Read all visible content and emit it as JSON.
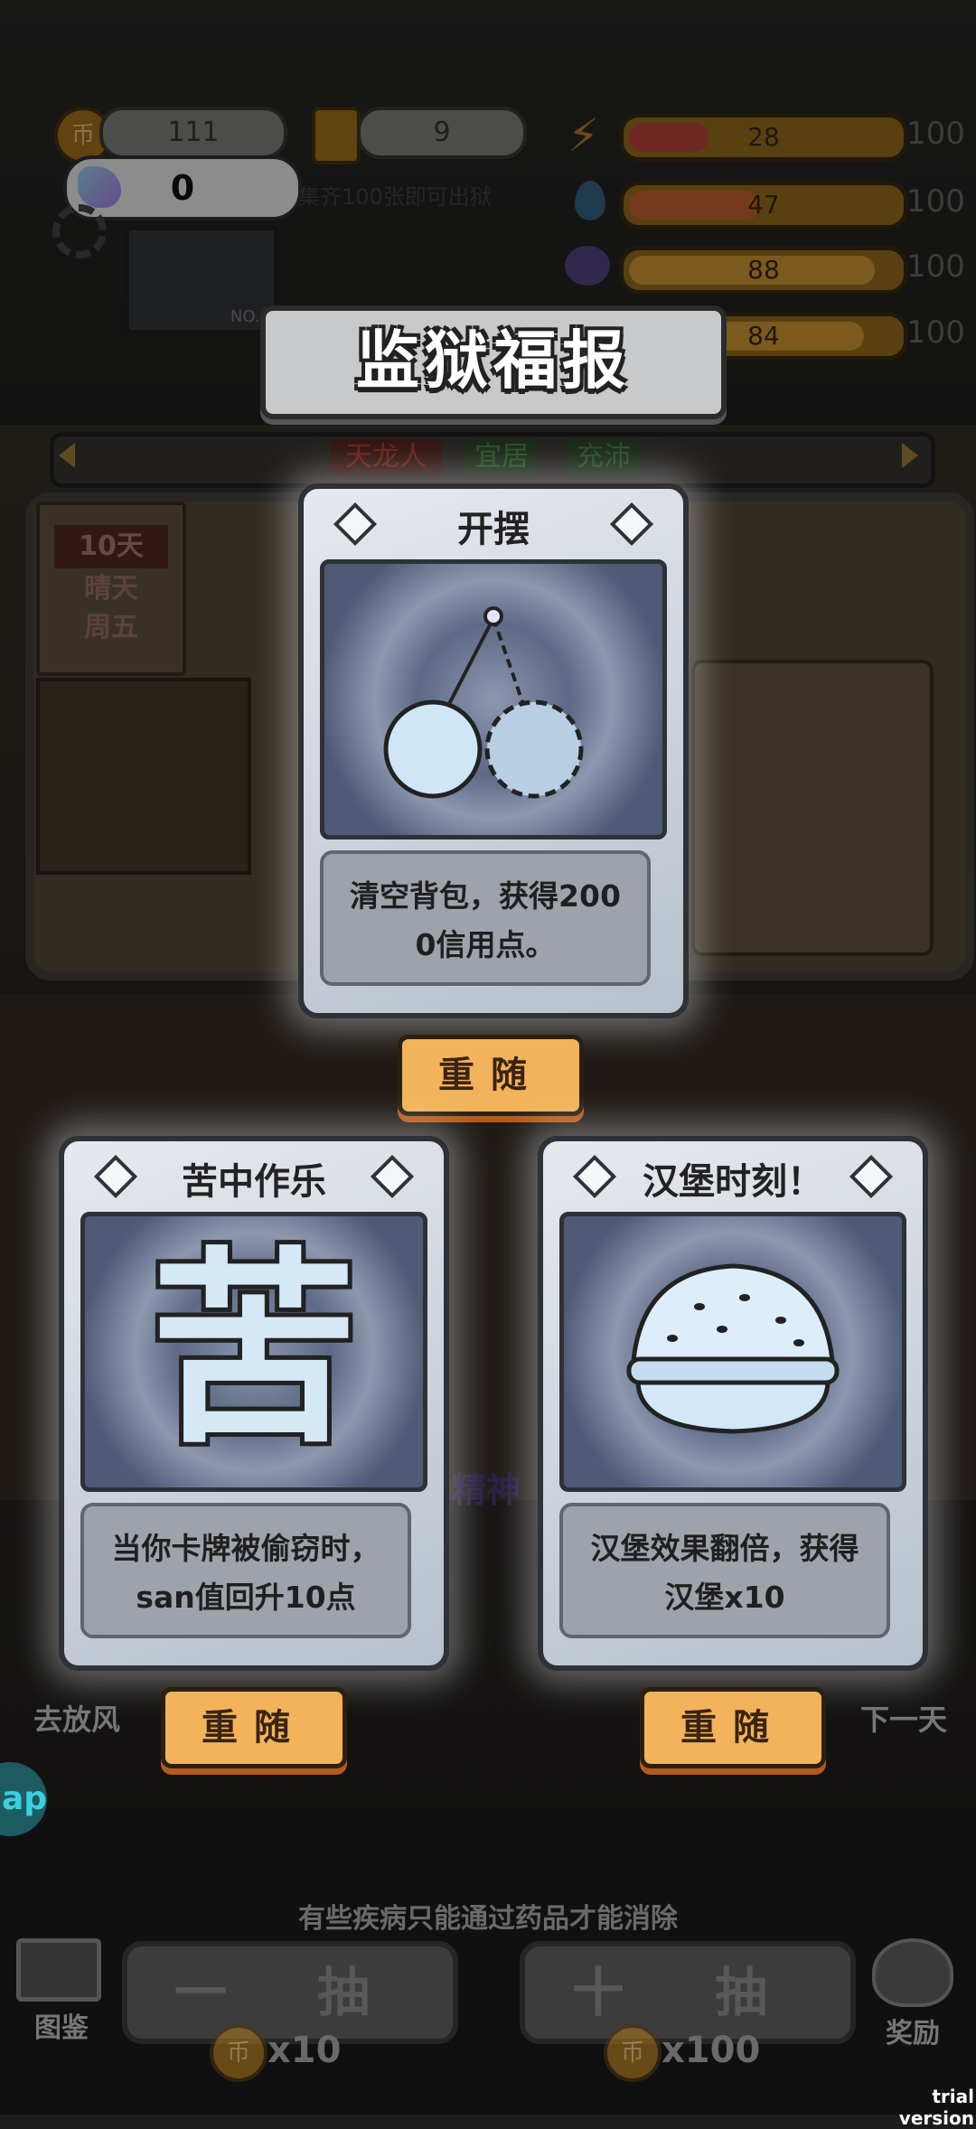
{
  "hud": {
    "coins": "111",
    "tickets": "9",
    "gems": "0",
    "collect_hint": "集齐100张即可出狱",
    "player_tag": "NO.4",
    "stats": [
      {
        "icon": "lightning-icon",
        "value": "28",
        "max": "100",
        "color": "#c84a3c",
        "fraction": 0.28
      },
      {
        "icon": "water-drop-icon",
        "value": "47",
        "max": "100",
        "color": "#d56a32",
        "fraction": 0.47
      },
      {
        "icon": "brain-icon",
        "value": "88",
        "max": "100",
        "color": "#e0a23a",
        "fraction": 0.88
      },
      {
        "icon": "stomach-icon",
        "value": "84",
        "max": "100",
        "color": "#e0a23a",
        "fraction": 0.84
      }
    ]
  },
  "banner_title": "监狱福报",
  "room": {
    "tags": [
      "天龙人",
      "宜居",
      "充沛"
    ],
    "tag_colors": [
      "#c0392b",
      "#4c8a46",
      "#4c8a46"
    ],
    "calendar": {
      "days": "10天",
      "weather": "晴天",
      "weekday": "周五"
    },
    "spirit_label": "精神"
  },
  "cards": [
    {
      "title": "开摆",
      "desc_line1": "清空背包，获得200",
      "desc_line2": "0信用点。",
      "reroll": "重随"
    },
    {
      "title": "苦中作乐",
      "art_glyph": "苦",
      "desc_line1": "当你卡牌被偷窃时，",
      "desc_line2": "san值回升10点",
      "reroll": "重随"
    },
    {
      "title": "汉堡时刻！",
      "desc_line1": "汉堡效果翻倍，获得",
      "desc_line2": "汉堡x10",
      "reroll": "重随"
    }
  ],
  "side": {
    "left_label": "去放风",
    "right_label": "下一天",
    "app_badge": "ap"
  },
  "bottom": {
    "hint": "有些疾病只能通过药品才能消除",
    "single_draw": "一 抽",
    "ten_draw": "十 抽",
    "single_cost": "x10",
    "ten_cost": "x100",
    "album": "图鉴",
    "reward": "奖励",
    "coin_glyph": "币"
  },
  "watermark": "trial version",
  "accent": "#f2b35a"
}
